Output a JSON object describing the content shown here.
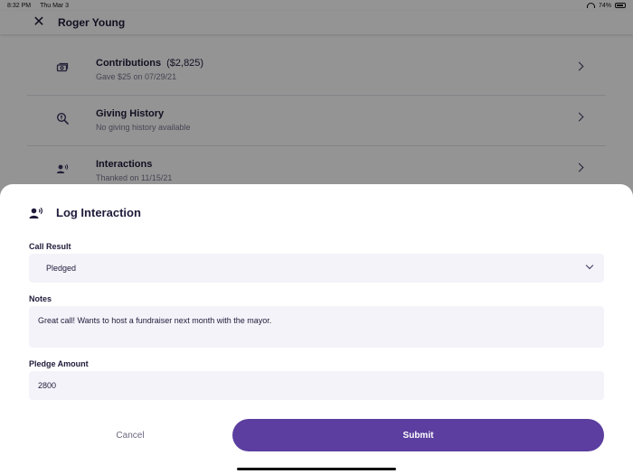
{
  "status_bar": {
    "time": "8:32 PM",
    "date": "Thu Mar 3",
    "battery": "74%"
  },
  "header": {
    "title": "Roger Young"
  },
  "list": [
    {
      "title": "Contributions",
      "amount": "($2,825)",
      "subtitle": "Gave $25 on 07/29/21",
      "icon": "money-icon"
    },
    {
      "title": "Giving History",
      "amount": "",
      "subtitle": "No giving history available",
      "icon": "search-money-icon"
    },
    {
      "title": "Interactions",
      "amount": "",
      "subtitle": "Thanked on 11/15/21",
      "icon": "person-voice-icon"
    }
  ],
  "modal": {
    "title": "Log Interaction",
    "call_result_label": "Call Result",
    "call_result_value": "Pledged",
    "notes_label": "Notes",
    "notes_value": "Great call!  Wants to host a fundraiser next month with the mayor.",
    "pledge_label": "Pledge Amount",
    "pledge_value": "2800",
    "cancel_label": "Cancel",
    "submit_label": "Submit"
  },
  "colors": {
    "accent": "#5b3e9f",
    "field_bg": "#f4f3f9",
    "text": "#1f1b3a"
  }
}
